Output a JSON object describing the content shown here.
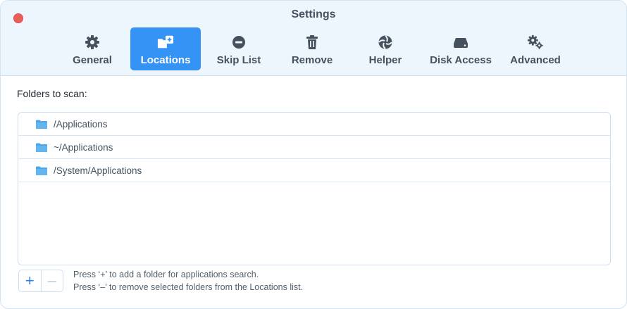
{
  "window": {
    "title": "Settings"
  },
  "tabs": [
    {
      "label": "General",
      "icon": "gear-icon",
      "active": false
    },
    {
      "label": "Locations",
      "icon": "folder-add-icon",
      "active": true
    },
    {
      "label": "Skip List",
      "icon": "minus-circle-icon",
      "active": false
    },
    {
      "label": "Remove",
      "icon": "trash-icon",
      "active": false
    },
    {
      "label": "Helper",
      "icon": "aperture-icon",
      "active": false
    },
    {
      "label": "Disk Access",
      "icon": "disk-icon",
      "active": false
    },
    {
      "label": "Advanced",
      "icon": "gears-icon",
      "active": false
    }
  ],
  "locations": {
    "heading": "Folders to scan:",
    "folders": [
      {
        "path": "/Applications"
      },
      {
        "path": "~/Applications"
      },
      {
        "path": "/System/Applications"
      }
    ],
    "add_label": "+",
    "remove_label": "–",
    "hint_add": "Press ‘+’ to add a folder for applications search.",
    "hint_remove": "Press ‘–’ to remove selected folders from the Locations list."
  },
  "colors": {
    "accent": "#3593f6",
    "titlebar_bg": "#eef6fd",
    "close_button": "#ec5f58",
    "folder_icon": "#4ea5e8"
  }
}
